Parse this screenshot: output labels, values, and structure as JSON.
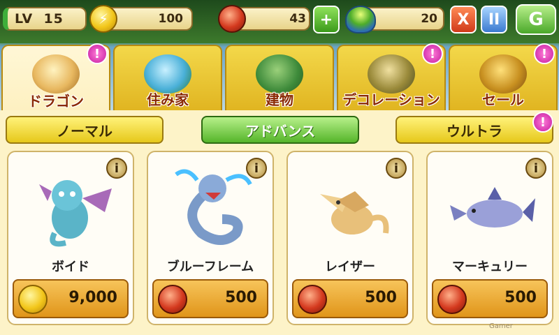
{
  "hud": {
    "level_label": "LV",
    "level_value": "15",
    "coins": "100",
    "gems": "43",
    "food": "20",
    "plus_label": "+",
    "close_label": "X",
    "pause_label": "II",
    "logo_label": "G"
  },
  "tabs": [
    {
      "label": "ドラゴン",
      "active": true,
      "alert": true
    },
    {
      "label": "住み家",
      "active": false,
      "alert": false
    },
    {
      "label": "建物",
      "active": false,
      "alert": false
    },
    {
      "label": "デコレーション",
      "active": false,
      "alert": true
    },
    {
      "label": "セール",
      "active": false,
      "alert": true
    }
  ],
  "subtabs": [
    {
      "label": "ノーマル",
      "active": false
    },
    {
      "label": "アドバンス",
      "active": true
    },
    {
      "label": "ウルトラ",
      "active": false,
      "alert": true
    }
  ],
  "alert_mark": "!",
  "info_mark": "i",
  "cards": [
    {
      "name": "ボイド",
      "price": "9,000",
      "currency": "coin",
      "color": "#5ab4c8"
    },
    {
      "name": "ブルーフレーム",
      "price": "500",
      "currency": "gem",
      "color": "#5a8ab8"
    },
    {
      "name": "レイザー",
      "price": "500",
      "currency": "gem",
      "color": "#e8c07a"
    },
    {
      "name": "マーキュリー",
      "price": "500",
      "currency": "gem",
      "color": "#9aa0d8"
    }
  ],
  "watermark": "Gamer"
}
